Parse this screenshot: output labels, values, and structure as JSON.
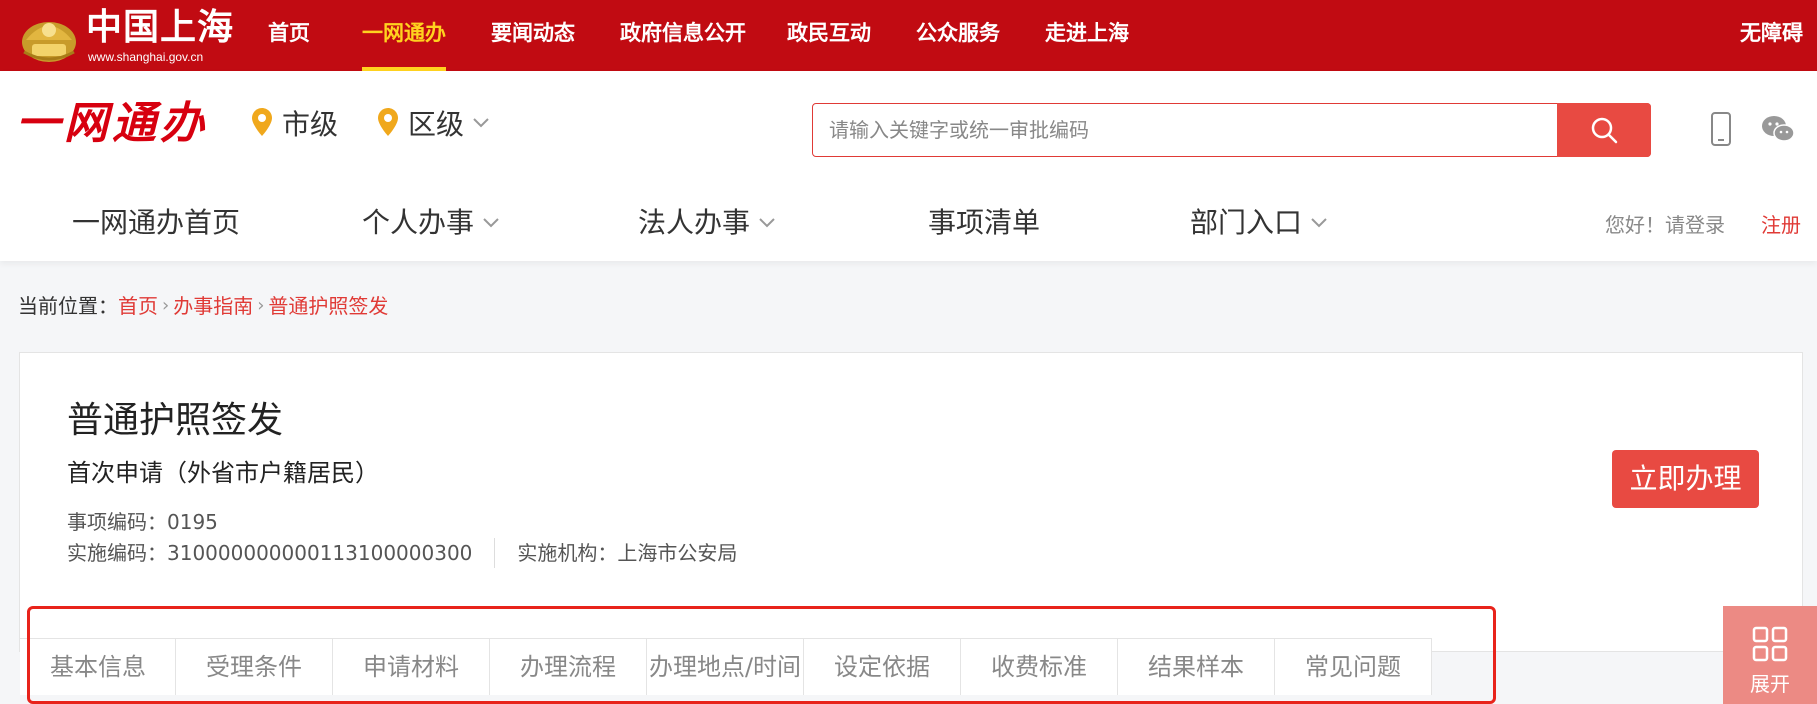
{
  "topbar": {
    "brand": "中国上海",
    "url": "www.shanghai.gov.cn",
    "nav": [
      {
        "label": "首页",
        "active": false
      },
      {
        "label": "一网通办",
        "active": true
      },
      {
        "label": "要闻动态",
        "active": false
      },
      {
        "label": "政府信息公开",
        "active": false
      },
      {
        "label": "政民互动",
        "active": false
      },
      {
        "label": "公众服务",
        "active": false
      },
      {
        "label": "走进上海",
        "active": false
      }
    ],
    "accessibility": "无障碍",
    "bg_color": "#c10b12",
    "active_color": "#ffd21f"
  },
  "header": {
    "service_logo": "一网通办",
    "loc_city": "市级",
    "loc_district": "区级",
    "search_placeholder": "请输入关键字或统一审批编码",
    "search_value": "",
    "icons": [
      "search-icon",
      "mobile-icon",
      "wechat-icon",
      "location-pin-icon",
      "chevron-down-icon"
    ],
    "subnav": [
      {
        "label": "一网通办首页",
        "dropdown": false
      },
      {
        "label": "个人办事",
        "dropdown": true
      },
      {
        "label": "法人办事",
        "dropdown": true
      },
      {
        "label": "事项清单",
        "dropdown": false
      },
      {
        "label": "部门入口",
        "dropdown": true
      }
    ],
    "greeting": "您好！请登录",
    "register": "注册",
    "accent_color": "#e84a42"
  },
  "breadcrumb": {
    "prefix": "当前位置：",
    "items": [
      "首页",
      "办事指南",
      "普通护照签发"
    ]
  },
  "item": {
    "title": "普通护照签发",
    "subtitle": "首次申请（外省市户籍居民）",
    "item_code": "事项编码：0195",
    "impl_code": "实施编码：310000000000113100000300",
    "agency": "实施机构：上海市公安局",
    "apply_button": "立即办理"
  },
  "tabs": [
    "基本信息",
    "受理条件",
    "申请材料",
    "办理流程",
    "办理地点/时间",
    "设定依据",
    "收费标准",
    "结果样本",
    "常见问题"
  ],
  "expand_label": "展开"
}
